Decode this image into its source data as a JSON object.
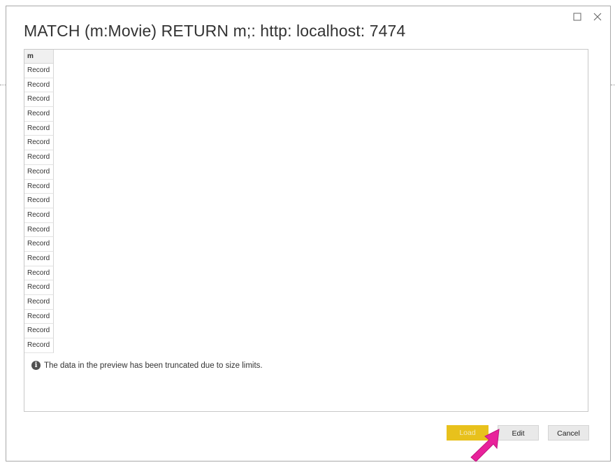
{
  "dialog": {
    "title": "MATCH (m:Movie) RETURN m;: http: localhost: 7474",
    "window_controls": {
      "maximize_icon": "maximize-icon",
      "close_icon": "close-icon"
    }
  },
  "preview_table": {
    "column_header": "m",
    "rows": [
      "Record",
      "Record",
      "Record",
      "Record",
      "Record",
      "Record",
      "Record",
      "Record",
      "Record",
      "Record",
      "Record",
      "Record",
      "Record",
      "Record",
      "Record",
      "Record",
      "Record",
      "Record",
      "Record",
      "Record"
    ]
  },
  "notice": {
    "icon": "info-icon",
    "text": "The data in the preview has been truncated due to size limits."
  },
  "buttons": {
    "load": "Load",
    "edit": "Edit",
    "cancel": "Cancel"
  },
  "annotation": {
    "icon": "pointer-arrow-icon",
    "color": "#e8229b"
  }
}
